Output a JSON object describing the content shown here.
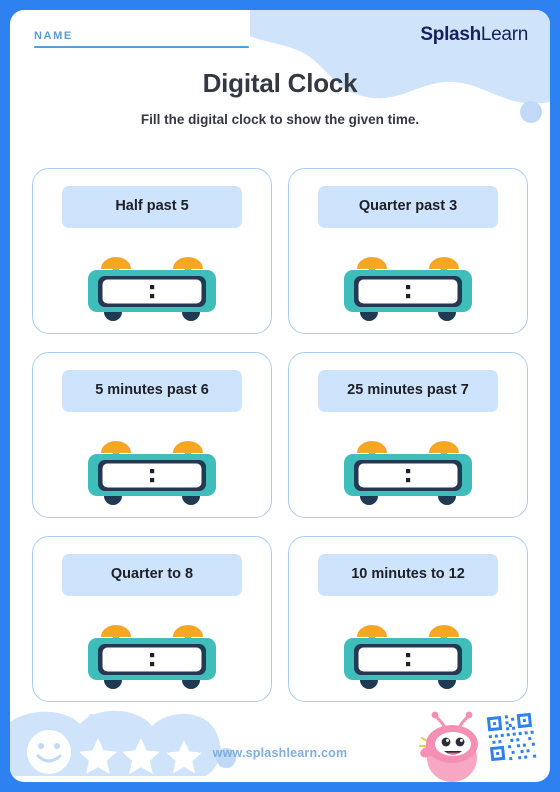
{
  "page": {
    "border_color": "#2E81F0",
    "sheet_background": "#ffffff"
  },
  "header": {
    "name_label": "NAME",
    "logo_bold": "Splash",
    "logo_light": "Learn",
    "title": "Digital Clock",
    "subtitle": "Fill the digital clock to show the given time."
  },
  "colors": {
    "accent_blue": "#2E81F0",
    "label_box": "#CEE3FC",
    "card_border": "#A9CDF0",
    "clock_body": "#3FBDBB",
    "clock_body_dark": "#1F3A52",
    "bell_orange": "#F5A623",
    "navy": "#16205C",
    "mascot_pink": "#F58FB4"
  },
  "clock": {
    "separator": ":",
    "icon_name": "alarm-clock-icon",
    "bell_count": 2,
    "display_value": ""
  },
  "cards": [
    {
      "id": 1,
      "label": "Half past 5"
    },
    {
      "id": 2,
      "label": "Quarter past 3"
    },
    {
      "id": 3,
      "label": "5 minutes past 6"
    },
    {
      "id": 4,
      "label": "25 minutes past 7"
    },
    {
      "id": 5,
      "label": "Quarter to 8"
    },
    {
      "id": 6,
      "label": "10 minutes to 12"
    }
  ],
  "footer": {
    "url": "www.splashlearn.com",
    "star_count": 3,
    "smiley_icon": "smiley-face-icon",
    "mascot_icon": "mascot-character-icon",
    "qr_icon": "qr-code-icon"
  }
}
